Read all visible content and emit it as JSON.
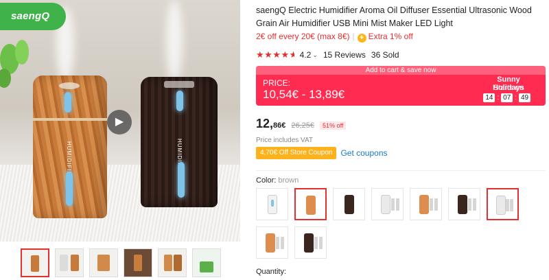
{
  "brand": {
    "logo_text": "saengQ"
  },
  "gallery": {
    "device_label_1": "HUMIDIFIER",
    "device_label_2": "HUMIDIFIER",
    "thumbnails": [
      {
        "kind": "wood"
      },
      {
        "kind": "variants"
      },
      {
        "kind": "wood-closeup"
      },
      {
        "kind": "wood-dark"
      },
      {
        "kind": "wood-pair"
      },
      {
        "kind": "lifestyle"
      }
    ],
    "selected_thumbnail": 0
  },
  "product": {
    "title": "saengQ Electric Humidifier Aroma Oil Diffuser Essential Ultrasonic Wood Grain Air Humidifier USB Mini Mist Maker LED Light",
    "promo": {
      "discount_text": "2€ off every 20€ (max 8€)",
      "separator": "|",
      "extra_icon": "+",
      "extra_text": "Extra 1% off"
    },
    "rating": {
      "score": 4.2,
      "score_text": "4.2",
      "reviews_text": "15 Reviews",
      "sold_text": "36 Sold"
    }
  },
  "deal": {
    "banner": "Add to cart & save now",
    "price_label": "PRICE:",
    "price_range": "10,54€ - 13,89€",
    "event_name": "Sunny Holidays",
    "starts_on": "Starts on",
    "timer": {
      "hours": "14",
      "minutes": "07",
      "seconds": "49",
      "separator": ":"
    }
  },
  "price": {
    "int": "12,",
    "dec": "86€",
    "original": "26,25€",
    "discount": "51% off",
    "vat_note": "Price includes VAT"
  },
  "coupons": {
    "store_coupon": "4,70€ Off Store Coupon",
    "get_link": "Get coupons"
  },
  "color": {
    "label": "Color:",
    "selected": "brown",
    "options": [
      {
        "type": "white"
      },
      {
        "type": "orange"
      },
      {
        "type": "dark"
      },
      {
        "type": "white-set"
      },
      {
        "type": "orange-set"
      },
      {
        "type": "dark-set"
      },
      {
        "type": "white-set-2"
      },
      {
        "type": "orange-set-2"
      },
      {
        "type": "dark-set-2"
      }
    ],
    "selected_indices": [
      1,
      6
    ]
  },
  "quantity": {
    "label": "Quantity:"
  },
  "colors": {
    "accent_red": "#e62e2e",
    "deal_red": "#ff2b50",
    "coupon_orange": "#fdb21c",
    "link_blue": "#1a79c9",
    "brand_green": "#3fb24a"
  }
}
